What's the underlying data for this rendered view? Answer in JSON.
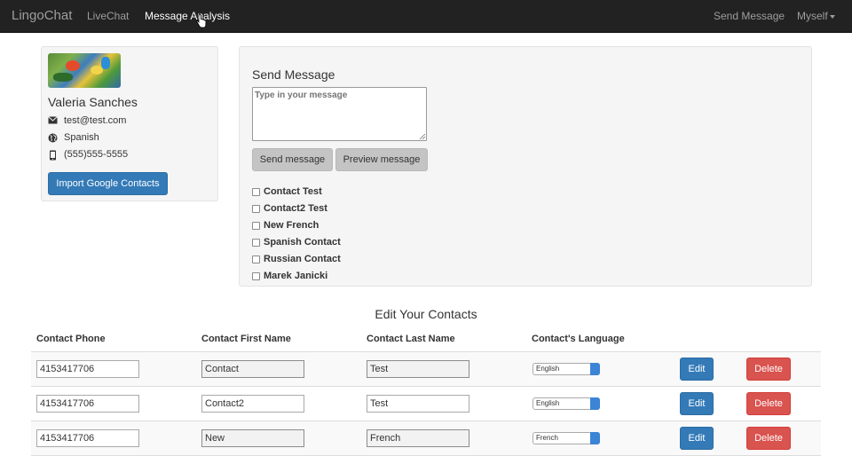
{
  "nav": {
    "brand": "LingoChat",
    "links": [
      "LiveChat",
      "Message Analysis"
    ],
    "right_links": [
      "Send Message"
    ],
    "user_menu": "Myself"
  },
  "profile": {
    "name": "Valeria Sanches",
    "email": "test@test.com",
    "language": "Spanish",
    "phone": "(555)555-5555",
    "import_button": "Import Google Contacts"
  },
  "send": {
    "title": "Send Message",
    "placeholder": "Type in your message",
    "send_button": "Send message",
    "preview_button": "Preview message",
    "recipients": [
      "Contact Test",
      "Contact2 Test",
      "New French",
      "Spanish Contact",
      "Russian Contact",
      "Marek Janicki"
    ]
  },
  "contacts": {
    "title": "Edit Your Contacts",
    "headers": [
      "Contact Phone",
      "Contact First Name",
      "Contact Last Name",
      "Contact's Language"
    ],
    "edit_label": "Edit",
    "delete_label": "Delete",
    "rows": [
      {
        "phone": "4153417706",
        "first": "Contact",
        "last": "Test",
        "language": "English"
      },
      {
        "phone": "4153417706",
        "first": "Contact2",
        "last": "Test",
        "language": "English"
      },
      {
        "phone": "4153417706",
        "first": "New",
        "last": "French",
        "language": "French"
      }
    ]
  },
  "colors": {
    "navbar": "#222222",
    "primary": "#337ab7",
    "danger": "#d9534f",
    "panel": "#f5f5f5"
  }
}
